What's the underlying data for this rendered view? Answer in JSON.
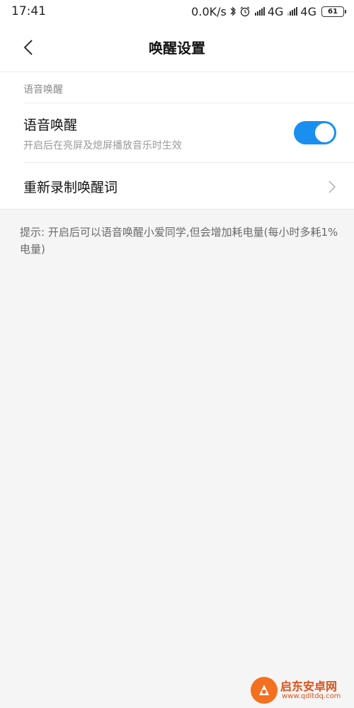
{
  "status_bar": {
    "time": "17:41",
    "speed": "0.0K/s",
    "network1": "4G",
    "network2": "4G",
    "battery": "61"
  },
  "header": {
    "title": "唤醒设置"
  },
  "section": {
    "label": "语音唤醒",
    "wake_row": {
      "title": "语音唤醒",
      "subtitle": "开启后在亮屏及熄屏播放音乐时生效",
      "toggle_on": true
    },
    "record_row": {
      "title": "重新录制唤醒词"
    }
  },
  "hint": "提示: 开启后可以语音唤醒小爱同学,但会增加耗电量(每小时多耗1%电量)",
  "watermark": {
    "name": "启东安卓网",
    "url": "www.qdltdq.com"
  },
  "colors": {
    "accent": "#1b8ff0",
    "background": "#f5f5f5"
  }
}
